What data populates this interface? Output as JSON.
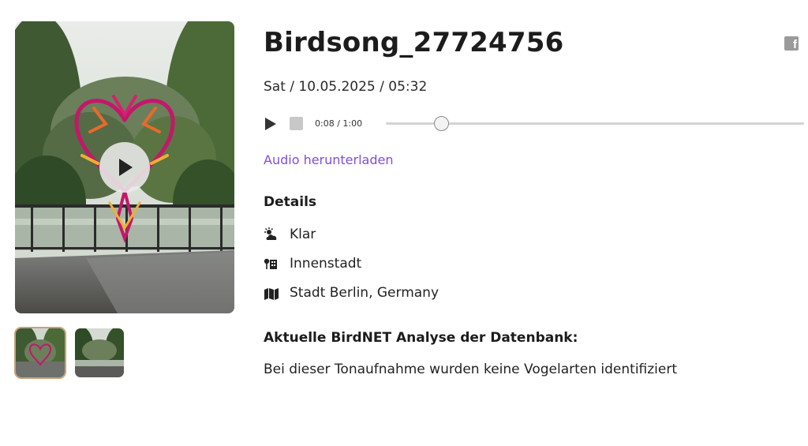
{
  "recording": {
    "title": "Birdsong_27724756",
    "date_line": "Sat / 10.05.2025 / 05:32"
  },
  "player": {
    "time_display": "0:08 / 1:00",
    "progress_fraction": 0.133
  },
  "download_label": "Audio herunterladen",
  "details": {
    "heading": "Details",
    "items": [
      {
        "icon": "weather-cloud-sun-icon",
        "label": "Klar"
      },
      {
        "icon": "city-tree-icon",
        "label": "Innenstadt"
      },
      {
        "icon": "map-icon",
        "label": "Stadt Berlin, Germany"
      }
    ]
  },
  "analysis": {
    "heading": "Aktuelle BirdNET Analyse der Datenbank:",
    "text": "Bei dieser Tonaufnahme wurden keine Vogelarten identifiziert"
  },
  "icons": {
    "share": "facebook-icon",
    "play": "play-icon",
    "stop": "stop-icon"
  },
  "colors": {
    "link": "#7e4fd6",
    "thumbnail_selected_border": "#c9a27a"
  }
}
